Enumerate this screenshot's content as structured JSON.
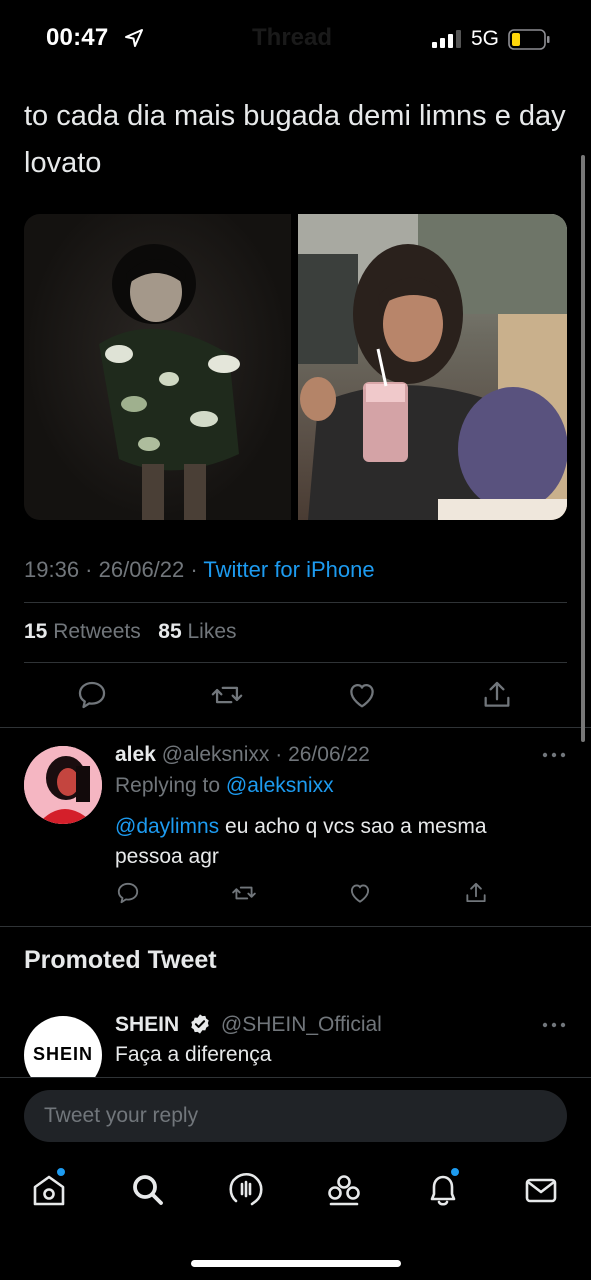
{
  "status_bar": {
    "time": "00:47",
    "network": "5G",
    "background_title": "Thread"
  },
  "tweet": {
    "text": "to cada dia mais bugada demi limns e day lovato",
    "time": "19:36",
    "date": "26/06/22",
    "source": "Twitter for iPhone",
    "retweets_count": "15",
    "retweets_label": "Retweets",
    "likes_count": "85",
    "likes_label": "Likes"
  },
  "reply": {
    "name": "alek",
    "handle": "@aleksnixx",
    "date": "26/06/22",
    "replying_label": "Replying to",
    "replying_handle": "@aleksnixx",
    "mention": "@daylimns",
    "text": "eu acho q vcs sao a mesma pessoa agr"
  },
  "promoted": {
    "heading": "Promoted Tweet",
    "name": "SHEIN",
    "handle": "@SHEIN_Official",
    "text": "Faça a diferença",
    "avatar_logo": "SHEIN"
  },
  "composer": {
    "placeholder": "Tweet your reply"
  },
  "nav": {
    "items": [
      "home-icon",
      "search-icon",
      "spaces-icon",
      "communities-icon",
      "notifications-icon",
      "messages-icon"
    ]
  },
  "colors": {
    "accent": "#1d9bf0",
    "battery_level": "#ffd60a",
    "background": "#000000",
    "secondary_text": "#71767b"
  }
}
